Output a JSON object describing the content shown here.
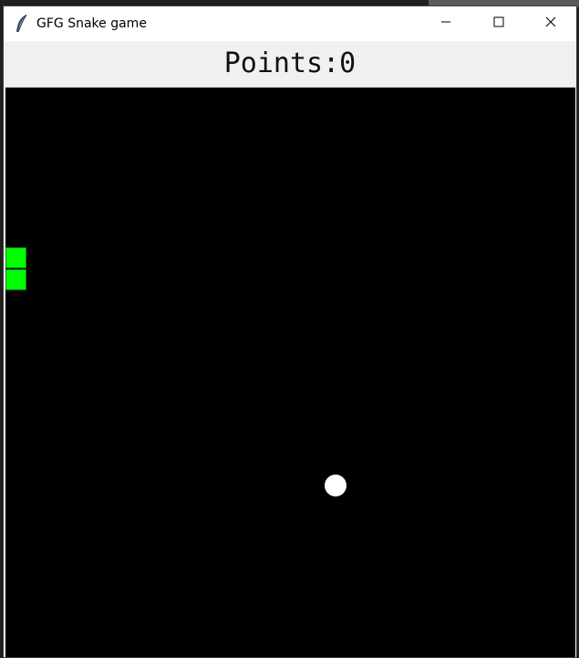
{
  "window": {
    "title": "GFG Snake game",
    "icon": "feather-icon",
    "controls": [
      "minimize-icon",
      "maximize-icon",
      "close-icon"
    ]
  },
  "game": {
    "score_text": "Points:0",
    "background_color": "#000000",
    "snake_color": "#00ff00",
    "food_color": "#ffffff"
  }
}
